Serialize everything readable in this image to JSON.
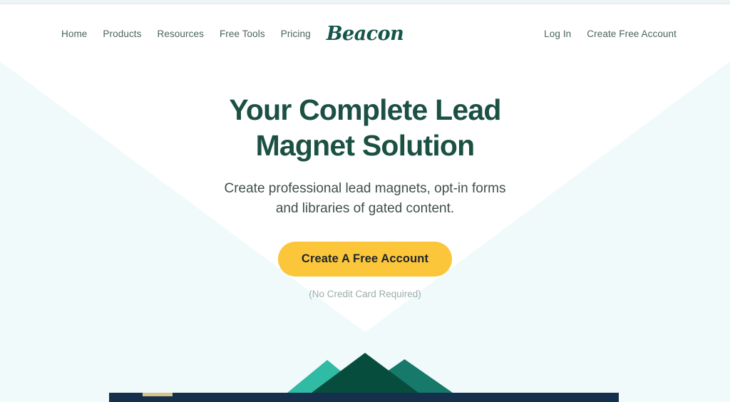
{
  "brand": {
    "name": "Beacon"
  },
  "nav": {
    "primary": [
      {
        "label": "Home",
        "name": "nav-link-home"
      },
      {
        "label": "Products",
        "name": "nav-link-products"
      },
      {
        "label": "Resources",
        "name": "nav-link-resources"
      },
      {
        "label": "Free Tools",
        "name": "nav-link-free-tools"
      },
      {
        "label": "Pricing",
        "name": "nav-link-pricing"
      }
    ],
    "secondary": [
      {
        "label": "Log In",
        "name": "nav-link-log-in"
      },
      {
        "label": "Create Free Account",
        "name": "nav-link-create-free-account"
      }
    ]
  },
  "hero": {
    "title_line1": "Your Complete Lead",
    "title_line2": "Magnet Solution",
    "subtitle_line1": "Create professional lead magnets, opt-in forms",
    "subtitle_line2": "and libraries of gated content.",
    "cta_label": "Create A Free Account",
    "cta_note": "(No Credit Card Required)"
  },
  "colors": {
    "brand_green": "#16564a",
    "heading_green": "#1b5043",
    "accent_yellow": "#fbc63a",
    "hero_background": "#f1fafa",
    "mountain_light": "#2fbba4",
    "mountain_mid": "#16796a",
    "mountain_dark": "#074d3e",
    "ground_navy": "#15304c",
    "body_text": "#3f4f4d",
    "muted_text": "#9aaeab"
  }
}
